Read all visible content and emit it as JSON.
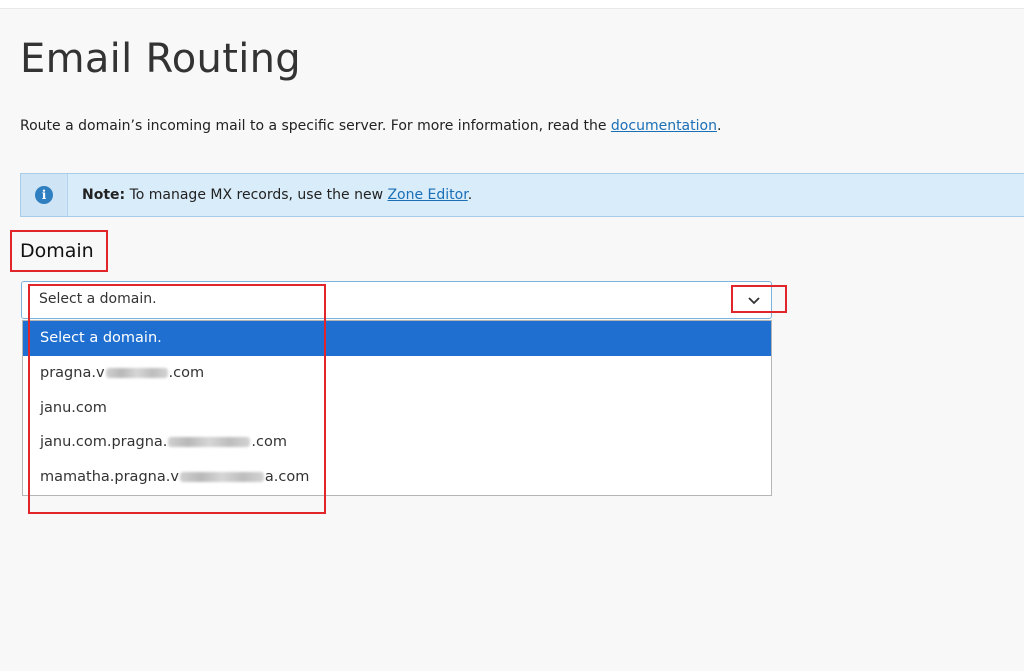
{
  "page": {
    "title": "Email Routing",
    "intro_text": "Route a domain’s incoming mail to a specific server. For more information, read the",
    "intro_link": "documentation",
    "intro_end": "."
  },
  "note": {
    "icon": "info-icon",
    "label": "Note:",
    "text": "To manage MX records, use the new",
    "link": "Zone Editor",
    "end": "."
  },
  "domain": {
    "label": "Domain",
    "selected": "Select a domain.",
    "options": [
      {
        "prefix": "Select a domain.",
        "suffix": ""
      },
      {
        "prefix": "pragna.v",
        "suffix": ".com"
      },
      {
        "prefix": "janu.com",
        "suffix": ""
      },
      {
        "prefix": "janu.com.pragna.",
        "suffix": ".com"
      },
      {
        "prefix": "mamatha.pragna.v",
        "suffix": "a.com"
      }
    ]
  },
  "colors": {
    "accent": "#1e6fcf",
    "link": "#1a6fb7",
    "note_bg": "#d9ecf9",
    "highlight": "#e0262a"
  }
}
